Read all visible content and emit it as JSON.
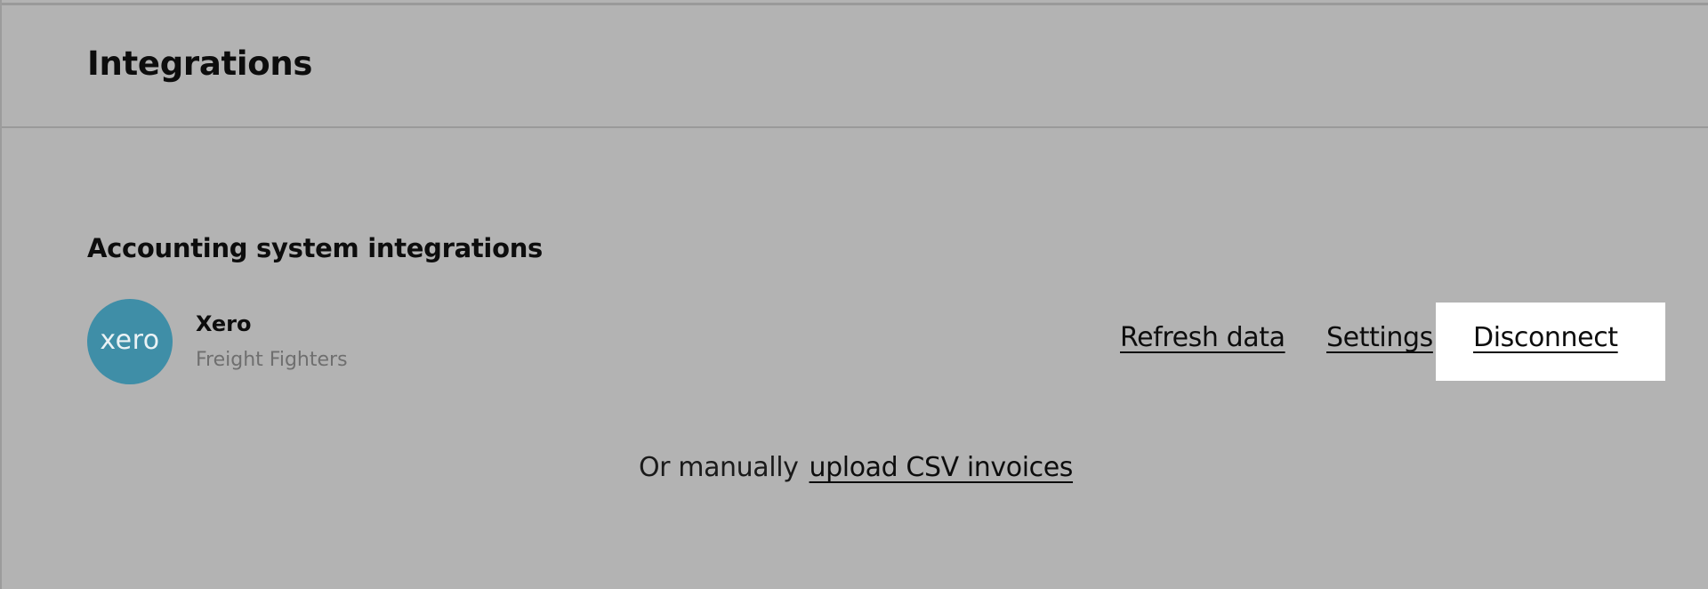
{
  "header": {
    "title": "Integrations"
  },
  "accounting": {
    "section_title": "Accounting system integrations",
    "integration": {
      "logo_text": "xero",
      "logo_color": "#3f8ea7",
      "name": "Xero",
      "organisation": "Freight Fighters",
      "actions": {
        "refresh": "Refresh data",
        "settings": "Settings",
        "disconnect": "Disconnect"
      }
    }
  },
  "manual_upload": {
    "prefix": "Or manually",
    "link": "upload CSV invoices"
  }
}
